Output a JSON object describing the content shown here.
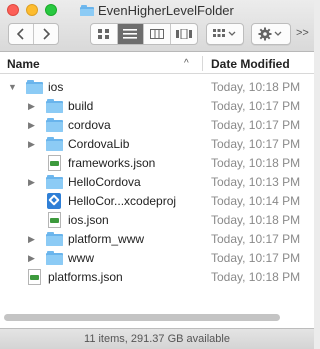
{
  "window": {
    "title": "EvenHigherLevelFolder"
  },
  "toolbar": {
    "back_icon": "chevron-left",
    "forward_icon": "chevron-right",
    "view_modes": [
      "icon",
      "list",
      "column",
      "cover-flow"
    ],
    "active_view": "list",
    "arrange_icon": "grid-arrange",
    "action_icon": "gear",
    "overflow_label": ">>"
  },
  "header": {
    "name_label": "Name",
    "date_label": "Date Modified",
    "sort_indicator": "^"
  },
  "rows": [
    {
      "name": "ios",
      "date": "Today, 10:18 PM",
      "kind": "folder",
      "level": 0,
      "expanded": true
    },
    {
      "name": "build",
      "date": "Today, 10:17 PM",
      "kind": "folder",
      "level": 1,
      "expanded": false
    },
    {
      "name": "cordova",
      "date": "Today, 10:17 PM",
      "kind": "folder",
      "level": 1,
      "expanded": false
    },
    {
      "name": "CordovaLib",
      "date": "Today, 10:17 PM",
      "kind": "folder",
      "level": 1,
      "expanded": false
    },
    {
      "name": "frameworks.json",
      "date": "Today, 10:18 PM",
      "kind": "json",
      "level": 1
    },
    {
      "name": "HelloCordova",
      "date": "Today, 10:13 PM",
      "kind": "folder",
      "level": 1,
      "expanded": false
    },
    {
      "name": "HelloCor...xcodeproj",
      "date": "Today, 10:14 PM",
      "kind": "xcodeproj",
      "level": 1
    },
    {
      "name": "ios.json",
      "date": "Today, 10:18 PM",
      "kind": "json",
      "level": 1
    },
    {
      "name": "platform_www",
      "date": "Today, 10:17 PM",
      "kind": "folder",
      "level": 1,
      "expanded": false
    },
    {
      "name": "www",
      "date": "Today, 10:17 PM",
      "kind": "folder",
      "level": 1,
      "expanded": false
    },
    {
      "name": "platforms.json",
      "date": "Today, 10:18 PM",
      "kind": "json",
      "level": 0
    }
  ],
  "status": {
    "text": "11 items, 291.37 GB available"
  },
  "colors": {
    "folder": "#69b4ec",
    "accent_dark": "#6d6d6d"
  }
}
